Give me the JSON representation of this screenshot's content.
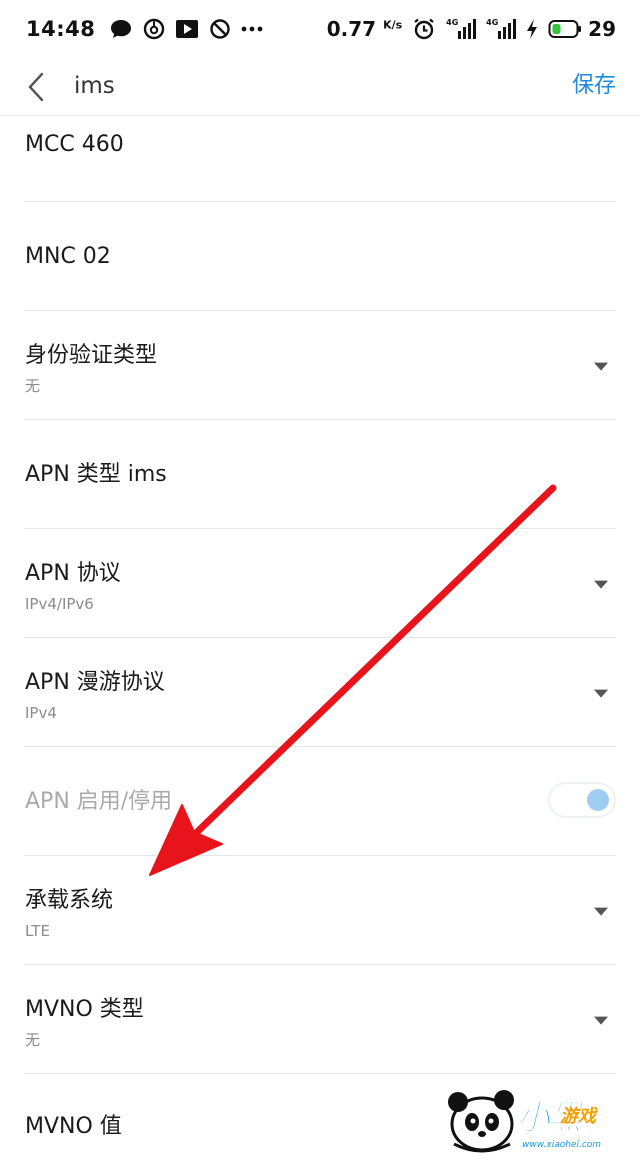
{
  "status_bar": {
    "time": "14:48",
    "speed_value": "0.77",
    "speed_unit": "K/s",
    "sim1_tag": "4G",
    "sim2_tag": "4G",
    "battery": "29",
    "icons": [
      "chat-bubble-icon",
      "netease-music-icon",
      "video-play-icon",
      "dnd-icon",
      "more-dots-icon",
      "alarm-icon",
      "signal-sim1-icon",
      "signal-sim2-icon",
      "charging-icon",
      "battery-icon"
    ]
  },
  "header": {
    "title": "ims",
    "save_label": "保存"
  },
  "rows": [
    {
      "title": "MCC 460",
      "subtitle": null,
      "control": "none"
    },
    {
      "title": "MNC 02",
      "subtitle": null,
      "control": "none"
    },
    {
      "title": "身份验证类型",
      "subtitle": "无",
      "control": "dropdown"
    },
    {
      "title": "APN 类型 ims",
      "subtitle": null,
      "control": "none"
    },
    {
      "title": "APN 协议",
      "subtitle": "IPv4/IPv6",
      "control": "dropdown"
    },
    {
      "title": "APN 漫游协议",
      "subtitle": "IPv4",
      "control": "dropdown"
    },
    {
      "title": "APN 启用/停用",
      "subtitle": null,
      "control": "toggle",
      "disabled": true,
      "toggle_on": true
    },
    {
      "title": "承载系统",
      "subtitle": "LTE",
      "control": "dropdown"
    },
    {
      "title": "MVNO 类型",
      "subtitle": "无",
      "control": "dropdown"
    },
    {
      "title": "MVNO 值",
      "subtitle": null,
      "control": "none"
    }
  ],
  "watermark": {
    "text": "小黑",
    "sub": "游戏",
    "url": "www.xiaohei.com"
  },
  "colors": {
    "accent": "#1e8ae0",
    "annotation_arrow": "#e8141b",
    "toggle_knob": "#9fcdf2"
  }
}
